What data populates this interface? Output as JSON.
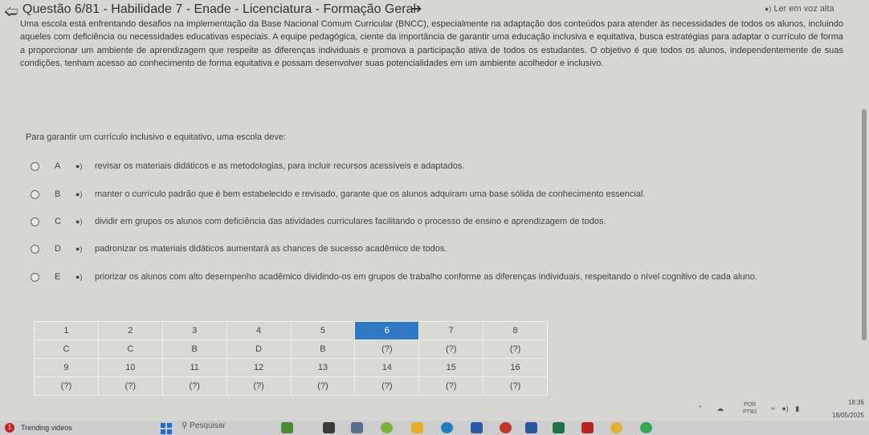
{
  "header": {
    "title": "Questão 6/81 - Habilidade 7 - Enade - Licenciatura - Formação Geral",
    "read_aloud_label": "Ler em voz alta"
  },
  "question": {
    "statement": "Uma escola está enfrentando desafios na implementação da Base Nacional Comum Curricular (BNCC), especialmente na adaptação dos conteúdos para atender às necessidades de todos os alunos, incluindo aqueles com deficiência ou necessidades educativas especiais. A equipe pedagógica, ciente da importância de garantir uma educação inclusiva e equitativa, busca estratégias para adaptar o currículo de forma a proporcionar um ambiente de aprendizagem que respeite as diferenças individuais e promova a participação ativa de todos os estudantes. O objetivo é que todos os alunos, independentemente de suas condições, tenham acesso ao conhecimento de forma equitativa e possam desenvolver suas potencialidades em um ambiente acolhedor e inclusivo.",
    "prompt": "Para garantir um currículo inclusivo e equitativo, uma escola deve:",
    "options": [
      {
        "letter": "A",
        "text": "revisar os materiais didáticos e as metodologias, para incluir recursos acessíveis e adaptados."
      },
      {
        "letter": "B",
        "text": "manter o currículo padrão que é bem estabelecido e revisado, garante que os alunos adquiram uma base sólida de conhecimento essencial."
      },
      {
        "letter": "C",
        "text": "dividir em grupos os alunos com deficiência das atividades curriculares facilitando o processo de ensino e aprendizagem de todos."
      },
      {
        "letter": "D",
        "text": "padronizar os materiais didáticos aumentará as chances de sucesso acadêmico de todos."
      },
      {
        "letter": "E",
        "text": "priorizar os alunos com alto desempenho acadêmico dividindo-os em grupos de trabalho conforme as diferenças individuais, respeitando o nível cognitivo de cada aluno."
      }
    ]
  },
  "answer_grid": {
    "rows": [
      [
        "1",
        "2",
        "3",
        "4",
        "5",
        "6",
        "7",
        "8"
      ],
      [
        "C",
        "C",
        "B",
        "D",
        "B",
        "(?)",
        "(?)",
        "(?)"
      ],
      [
        "9",
        "10",
        "11",
        "12",
        "13",
        "14",
        "15",
        "16"
      ],
      [
        "(?)",
        "(?)",
        "(?)",
        "(?)",
        "(?)",
        "(?)",
        "(?)",
        "(?)"
      ]
    ],
    "active_number": "6"
  },
  "taskbar": {
    "news_badge": "1",
    "news_label": "Trending videos",
    "search_placeholder": "Pesquisar",
    "language_line1": "POR",
    "language_line2": "PTB2",
    "time": "18:36",
    "date": "18/05/2025",
    "pinned_icons": [
      "stocks-icon",
      "terminal-icon",
      "chart-app-icon",
      "colorful-app-icon",
      "folder-icon",
      "edge-icon",
      "store-icon",
      "app-icon",
      "word-icon",
      "excel-icon",
      "acrobat-icon",
      "chrome-icon",
      "chrome-alt-icon"
    ]
  },
  "colors": {
    "background": "#d6d6d3",
    "active_cell": "#2f79c7",
    "taskbar": "#cdcdd0"
  }
}
